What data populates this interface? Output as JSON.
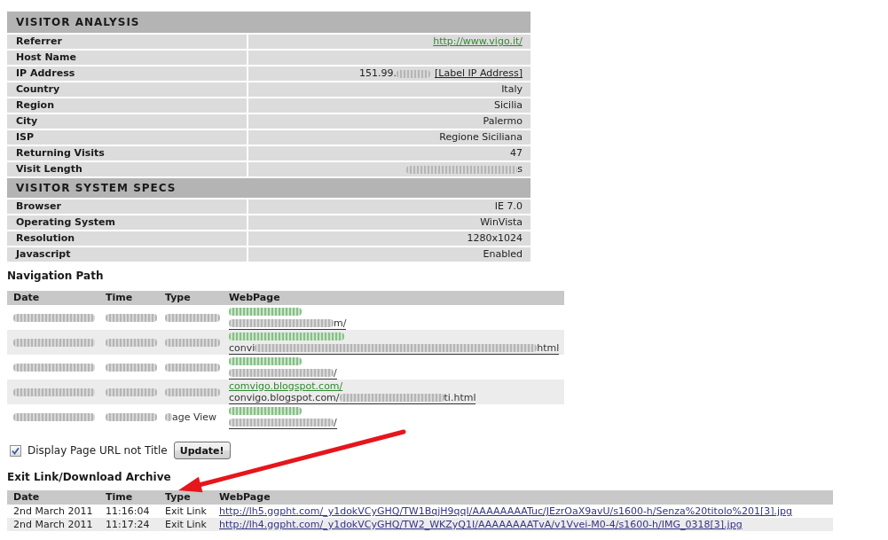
{
  "visitor_analysis": {
    "title": "VISITOR ANALYSIS",
    "rows": [
      {
        "label": "Referrer",
        "parts": [
          {
            "kind": "greenlink",
            "text": "http://www.vigo.it/"
          }
        ]
      },
      {
        "label": "Host Name"
      },
      {
        "label": "IP Address",
        "parts": [
          {
            "kind": "text",
            "text": "151.99."
          },
          {
            "kind": "shortblur"
          },
          {
            "kind": "link",
            "text": "[Label IP Address]"
          }
        ]
      },
      {
        "label": "Country",
        "parts": [
          {
            "kind": "text",
            "text": "Italy"
          }
        ]
      },
      {
        "label": "Region",
        "parts": [
          {
            "kind": "text",
            "text": "Sicilia"
          }
        ]
      },
      {
        "label": "City",
        "parts": [
          {
            "kind": "text",
            "text": "Palermo"
          }
        ]
      },
      {
        "label": "ISP",
        "parts": [
          {
            "kind": "text",
            "text": "Regione Siciliana"
          }
        ]
      },
      {
        "label": "Returning Visits",
        "parts": [
          {
            "kind": "text",
            "text": "47"
          }
        ]
      },
      {
        "label": "Visit Length",
        "parts": [
          {
            "kind": "longblur"
          },
          {
            "kind": "text",
            "text": "s"
          }
        ]
      }
    ]
  },
  "system_specs": {
    "title": "VISITOR SYSTEM SPECS",
    "rows": [
      {
        "label": "Browser",
        "parts": [
          {
            "kind": "text",
            "text": "IE 7.0"
          }
        ]
      },
      {
        "label": "Operating System",
        "parts": [
          {
            "kind": "text",
            "text": "WinVista"
          }
        ]
      },
      {
        "label": "Resolution",
        "parts": [
          {
            "kind": "text",
            "text": "1280x1024"
          }
        ]
      },
      {
        "label": "Javascript",
        "parts": [
          {
            "kind": "text",
            "text": "Enabled"
          }
        ]
      }
    ]
  },
  "navigation_path": {
    "title": "Navigation Path",
    "columns": [
      "Date",
      "Time",
      "Type",
      "WebPage"
    ],
    "rows": [
      {
        "date": [
          {
            "kind": "blur"
          }
        ],
        "time": [
          {
            "kind": "blur"
          }
        ],
        "type": [
          {
            "kind": "blur"
          }
        ],
        "title_line": [
          {
            "kind": "blur"
          }
        ],
        "url_line": [
          {
            "kind": "blur"
          },
          {
            "kind": "text",
            "text": "m/"
          }
        ]
      },
      {
        "date": [
          {
            "kind": "blur"
          }
        ],
        "time": [
          {
            "kind": "blur"
          }
        ],
        "type": [
          {
            "kind": "blur"
          }
        ],
        "title_line": [
          {
            "kind": "longblur"
          }
        ],
        "url_line": [
          {
            "kind": "text",
            "text": "convi"
          },
          {
            "kind": "longblur"
          },
          {
            "kind": "text",
            "text": "html"
          }
        ]
      },
      {
        "date": [
          {
            "kind": "blur"
          }
        ],
        "time": [
          {
            "kind": "blur"
          }
        ],
        "type": [
          {
            "kind": "blur"
          }
        ],
        "title_line": [
          {
            "kind": "blur"
          }
        ],
        "url_line": [
          {
            "kind": "blur"
          },
          {
            "kind": "text",
            "text": "/"
          }
        ]
      },
      {
        "date": [
          {
            "kind": "blur"
          }
        ],
        "time": [
          {
            "kind": "blur"
          }
        ],
        "type": [
          {
            "kind": "blur"
          }
        ],
        "title_line": [
          {
            "kind": "greenlink",
            "text": "comvigo.blogspot.com/"
          }
        ],
        "url_line": [
          {
            "kind": "text",
            "text": "convigo.blogspot.com/"
          },
          {
            "kind": "blur"
          },
          {
            "kind": "text",
            "text": "ti.html"
          }
        ]
      },
      {
        "date": [
          {
            "kind": "blur"
          }
        ],
        "time": [
          {
            "kind": "blur"
          }
        ],
        "type": [
          {
            "kind": "shortblur"
          },
          {
            "kind": "text",
            "text": "age View"
          }
        ],
        "title_line": [
          {
            "kind": "blur"
          }
        ],
        "url_line": [
          {
            "kind": "blur"
          },
          {
            "kind": "text",
            "text": "/"
          }
        ]
      }
    ]
  },
  "display_options": {
    "label": "Display Page URL not Title",
    "checked": true,
    "button": "Update!"
  },
  "exit_links": {
    "title": "Exit Link/Download Archive",
    "columns": [
      "Date",
      "Time",
      "Type",
      "WebPage"
    ],
    "rows": [
      {
        "date": "2nd March 2011",
        "time": "11:16:04",
        "type": "Exit Link",
        "url": "http://lh5.ggpht.com/_y1dokVCyGHQ/TW1BqjH9qqI/AAAAAAAATuc/JEzrOaX9avU/s1600-h/Senza%20titolo%201[3].jpg"
      },
      {
        "date": "2nd March 2011",
        "time": "11:17:24",
        "type": "Exit Link",
        "url": "http://lh4.ggpht.com/_y1dokVCyGHQ/TW2_WKZyQ1I/AAAAAAAATvA/v1Vvei-M0-4/s1600-h/IMG_0318[3].jpg"
      }
    ]
  },
  "annotation": {
    "kind": "arrow"
  }
}
